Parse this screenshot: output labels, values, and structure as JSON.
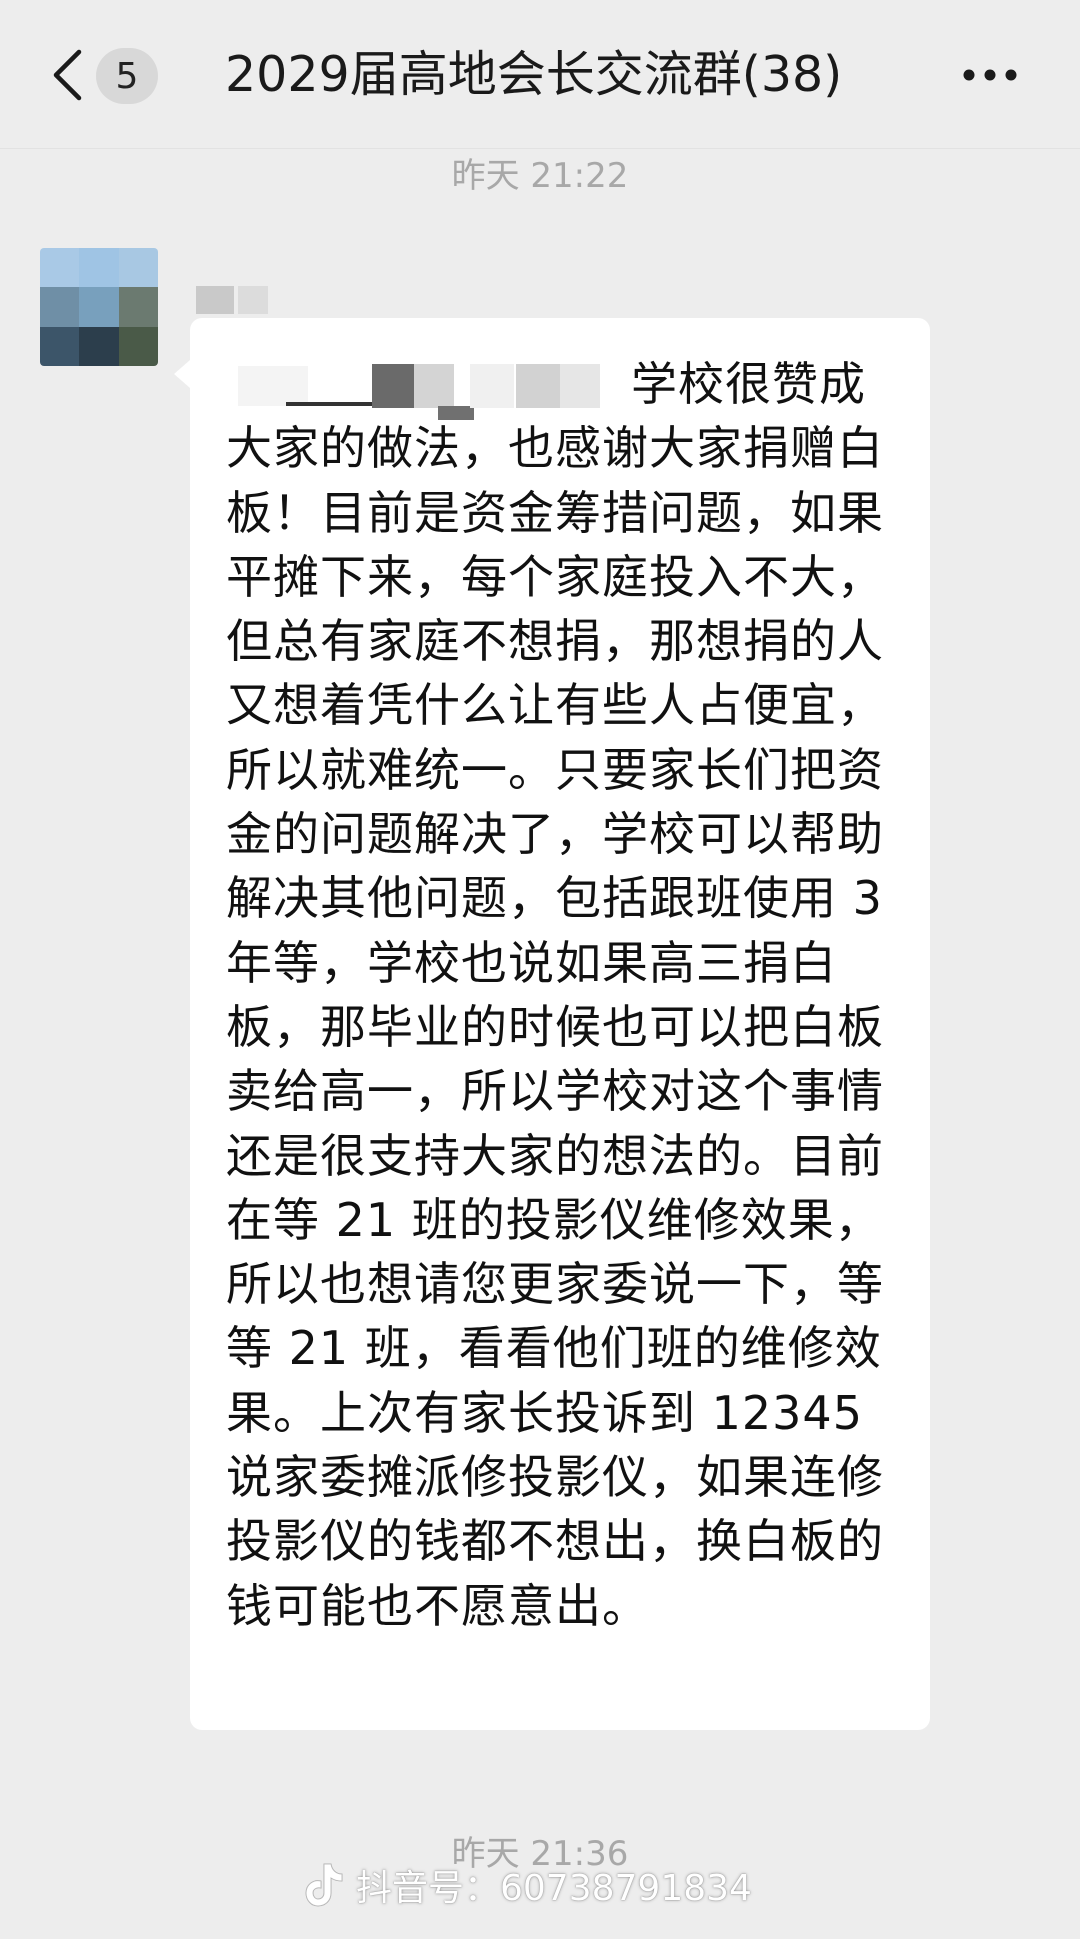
{
  "header": {
    "back_icon": "chevron-left-icon",
    "unread_count": "5",
    "title": "2029届高地会长交流群(38)",
    "more_icon": "more-horizontal-icon"
  },
  "messages": {
    "timestamp_1": "昨天 21:22",
    "message_text": "学校很赞成大家的做法，也感谢大家捐赠白板！目前是资金筹措问题，如果平摊下来，每个家庭投入不大，但总有家庭不想捐，那想捐的人又想着凭什么让有些人占便宜，所以就难统一。只要家长们把资金的问题解决了，学校可以帮助解决其他问题，包括跟班使用 3 年等，学校也说如果高三捐白板，那毕业的时候也可以把白板卖给高一，所以学校对这个事情还是很支持大家的想法的。目前在等 21 班的投影仪维修效果，所以也想请您更家委说一下，等等 21 班，看看他们班的维修效果。上次有家长投诉到 12345 说家委摊派修投影仪，如果连修投影仪的钱都不想出，换白板的钱可能也不愿意出。",
    "timestamp_2": "昨天 21:36"
  },
  "watermark": {
    "icon": "tiktok-logo-icon",
    "text": "抖音号：60738791834"
  },
  "colors": {
    "background": "#ededed",
    "bubble": "#ffffff",
    "timestamp": "#a8a8a8"
  }
}
